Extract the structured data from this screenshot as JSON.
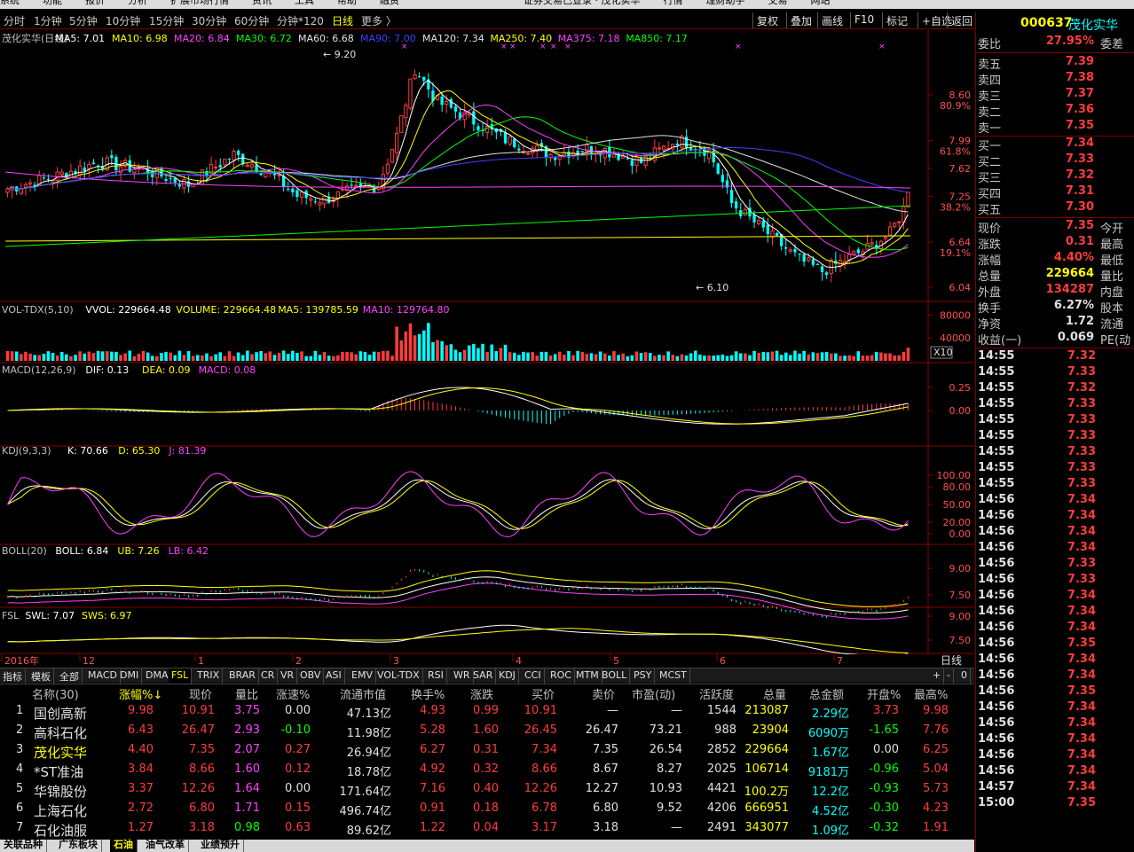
{
  "menubar": [
    "系统",
    "功能",
    "报价",
    "分析",
    "扩展市场行情",
    "资讯",
    "工具",
    "帮助",
    "融资",
    "证券交易已登录 · 茂化实华",
    "行情",
    "理财助手",
    "交易",
    "网站"
  ],
  "period_bar": {
    "items": [
      "分时",
      "1分钟",
      "5分钟",
      "10分钟",
      "15分钟",
      "30分钟",
      "60分钟",
      "分钟*120",
      "日线",
      "更多 〉"
    ],
    "active": "日线",
    "buttons": [
      "复权",
      "叠加",
      "画线",
      "F10",
      "标记",
      "+自选",
      "返回"
    ]
  },
  "right_panel": {
    "code": "000637",
    "name": "茂化实华",
    "weibi": {
      "label": "委比",
      "value": "27.95%",
      "label2": "委差"
    },
    "asks": [
      {
        "label": "卖五",
        "price": "7.39"
      },
      {
        "label": "卖四",
        "price": "7.38"
      },
      {
        "label": "卖三",
        "price": "7.37"
      },
      {
        "label": "卖二",
        "price": "7.36"
      },
      {
        "label": "卖一",
        "price": "7.35"
      }
    ],
    "bids": [
      {
        "label": "买一",
        "price": "7.34"
      },
      {
        "label": "买二",
        "price": "7.33"
      },
      {
        "label": "买三",
        "price": "7.32"
      },
      {
        "label": "买四",
        "price": "7.31"
      },
      {
        "label": "买五",
        "price": "7.30"
      }
    ],
    "stats": [
      {
        "label": "现价",
        "value": "7.35",
        "label2": "今开",
        "color": "#ff3c3c"
      },
      {
        "label": "涨跌",
        "value": "0.31",
        "label2": "最高",
        "color": "#ff3c3c"
      },
      {
        "label": "涨幅",
        "value": "4.40%",
        "label2": "最低",
        "color": "#ff3c3c"
      },
      {
        "label": "总量",
        "value": "229664",
        "label2": "量比",
        "color": "#ffff00"
      },
      {
        "label": "外盘",
        "value": "134287",
        "label2": "内盘",
        "color": "#ff3c3c"
      },
      {
        "label": "换手",
        "value": "6.27%",
        "label2": "股本",
        "color": "#e0e0e0"
      },
      {
        "label": "净资",
        "value": "1.72",
        "label2": "流通",
        "color": "#e0e0e0"
      },
      {
        "label": "收益(一)",
        "value": "0.069",
        "label2": "PE(动",
        "color": "#e0e0e0"
      }
    ],
    "ticks": [
      {
        "time": "14:55",
        "price": "7.32"
      },
      {
        "time": "14:55",
        "price": "7.33"
      },
      {
        "time": "14:55",
        "price": "7.32"
      },
      {
        "time": "14:55",
        "price": "7.33"
      },
      {
        "time": "14:55",
        "price": "7.33"
      },
      {
        "time": "14:55",
        "price": "7.33"
      },
      {
        "time": "14:55",
        "price": "7.33"
      },
      {
        "time": "14:55",
        "price": "7.33"
      },
      {
        "time": "14:55",
        "price": "7.33"
      },
      {
        "time": "14:56",
        "price": "7.34"
      },
      {
        "time": "14:56",
        "price": "7.34"
      },
      {
        "time": "14:56",
        "price": "7.34"
      },
      {
        "time": "14:56",
        "price": "7.34"
      },
      {
        "time": "14:56",
        "price": "7.33"
      },
      {
        "time": "14:56",
        "price": "7.33"
      },
      {
        "time": "14:56",
        "price": "7.34"
      },
      {
        "time": "14:56",
        "price": "7.34"
      },
      {
        "time": "14:56",
        "price": "7.34"
      },
      {
        "time": "14:56",
        "price": "7.35"
      },
      {
        "time": "14:56",
        "price": "7.34"
      },
      {
        "time": "14:56",
        "price": "7.34"
      },
      {
        "time": "14:56",
        "price": "7.35"
      },
      {
        "time": "14:56",
        "price": "7.34"
      },
      {
        "time": "14:56",
        "price": "7.34"
      },
      {
        "time": "14:56",
        "price": "7.34"
      },
      {
        "time": "14:56",
        "price": "7.34"
      },
      {
        "time": "14:56",
        "price": "7.34"
      },
      {
        "time": "14:57",
        "price": "7.34"
      },
      {
        "time": "15:00",
        "price": "7.35"
      }
    ]
  },
  "chart": {
    "title": "茂化实华(日线)",
    "ma_labels": [
      {
        "text": "MA5: 7.01",
        "color": "#ffffff"
      },
      {
        "text": "MA10: 6.98",
        "color": "#ffff00"
      },
      {
        "text": "MA20: 6.84",
        "color": "#ff40ff"
      },
      {
        "text": "MA30: 6.72",
        "color": "#00ff00"
      },
      {
        "text": "MA60: 6.68",
        "color": "#e0e0e0"
      },
      {
        "text": "MA90: 7.00",
        "color": "#4040ff"
      },
      {
        "text": "MA120: 7.34",
        "color": "#e0e0e0"
      },
      {
        "text": "MA250: 7.40",
        "color": "#ffff00"
      },
      {
        "text": "MA375: 7.18",
        "color": "#ff40ff"
      },
      {
        "text": "MA850: 7.17",
        "color": "#00ff00"
      }
    ],
    "price_ticks": [
      "8.60",
      "7.99",
      "7.62",
      "7.25",
      "6.64",
      "6.04"
    ],
    "pct_ticks": [
      "80.9%",
      "61.8%",
      "38.2%",
      "19.1%"
    ],
    "high_label": "9.20",
    "low_label": "6.10",
    "vol_title": "VOL-TDX(5,10)",
    "vol_labels": [
      {
        "text": "VVOL: 229664.48",
        "color": "#ffffff"
      },
      {
        "text": "VOLUME: 229664.48",
        "color": "#ffff00"
      },
      {
        "text": "MA5: 139785.59",
        "color": "#ffff00"
      },
      {
        "text": "MA10: 129764.80",
        "color": "#ff40ff"
      }
    ],
    "vol_ticks": [
      "80000",
      "40000"
    ],
    "vol_unit": "X10",
    "macd_title": "MACD(12,26,9)",
    "macd_labels": [
      {
        "text": "DIF: 0.13",
        "color": "#ffffff"
      },
      {
        "text": "DEA: 0.09",
        "color": "#ffff00"
      },
      {
        "text": "MACD: 0.08",
        "color": "#ff40ff"
      }
    ],
    "macd_ticks": [
      "0.25",
      "0.00"
    ],
    "kdj_title": "KDJ(9,3,3)",
    "kdj_labels": [
      {
        "text": "K: 70.66",
        "color": "#ffffff"
      },
      {
        "text": "D: 65.30",
        "color": "#ffff00"
      },
      {
        "text": "J: 81.39",
        "color": "#ff40ff"
      }
    ],
    "kdj_ticks": [
      "100.00",
      "80.00",
      "50.00",
      "20.00",
      "0.00"
    ],
    "boll_title": "BOLL(20)",
    "boll_labels": [
      {
        "text": "BOLL: 6.84",
        "color": "#ffffff"
      },
      {
        "text": "UB: 7.26",
        "color": "#ffff00"
      },
      {
        "text": "LB: 6.42",
        "color": "#ff40ff"
      }
    ],
    "boll_ticks": [
      "9.00",
      "7.50"
    ],
    "fsl_title": "FSL",
    "fsl_labels": [
      {
        "text": "SWL: 7.07",
        "color": "#ffffff"
      },
      {
        "text": "SWS: 6.97",
        "color": "#ffff00"
      }
    ],
    "fsl_ticks": [
      "9.00",
      "7.50"
    ],
    "date_axis": [
      "2016年",
      "12",
      "1",
      "2",
      "3",
      "4",
      "5",
      "6",
      "7"
    ],
    "period_label": "日线"
  },
  "indicator_tabs": [
    "指标",
    "模板",
    "全部",
    "MACD",
    "DMI",
    "DMA",
    "FSL",
    "TRIX",
    "BRAR",
    "CR",
    "VR",
    "OBV",
    "ASI",
    "EMV",
    "VOL-TDX",
    "RSI",
    "WR",
    "SAR",
    "KDJ",
    "CCI",
    "ROC",
    "MTM",
    "BOLL",
    "PSY",
    "MCST"
  ],
  "active_indicator_tab": "FSL",
  "nav_buttons": [
    "+",
    "-",
    "0"
  ],
  "table": {
    "headers": [
      "名称(30)",
      "涨幅%↓",
      "现价",
      "量比",
      "涨速%",
      "流通市值",
      "换手%",
      "涨跌",
      "买价",
      "卖价",
      "市盈(动)",
      "活跃度",
      "总量",
      "总金额",
      "开盘%",
      "最高%"
    ],
    "rows": [
      {
        "idx": "1",
        "name": "国创高新",
        "cells": [
          "9.98",
          "10.91",
          "3.75",
          "0.00",
          "47.13亿",
          "4.93",
          "0.99",
          "10.91",
          "—",
          "—",
          "1544",
          "213087",
          "2.29亿",
          "3.73",
          "9.98"
        ]
      },
      {
        "idx": "2",
        "name": "高科石化",
        "cells": [
          "6.43",
          "26.47",
          "2.93",
          "-0.10",
          "11.98亿",
          "5.28",
          "1.60",
          "26.45",
          "26.47",
          "73.21",
          "988",
          "23904",
          "6090万",
          "-1.65",
          "7.76"
        ]
      },
      {
        "idx": "3",
        "name": "茂化实华",
        "cells": [
          "4.40",
          "7.35",
          "2.07",
          "0.27",
          "26.94亿",
          "6.27",
          "0.31",
          "7.34",
          "7.35",
          "26.54",
          "2852",
          "229664",
          "1.67亿",
          "0.00",
          "6.25"
        ]
      },
      {
        "idx": "4",
        "name": "*ST准油",
        "cells": [
          "3.84",
          "8.66",
          "1.60",
          "0.12",
          "18.78亿",
          "4.92",
          "0.32",
          "8.66",
          "8.67",
          "8.27",
          "2025",
          "106714",
          "9181万",
          "-0.96",
          "5.04"
        ]
      },
      {
        "idx": "5",
        "name": "华锦股份",
        "cells": [
          "3.37",
          "12.26",
          "1.64",
          "0.00",
          "171.64亿",
          "7.16",
          "0.40",
          "12.26",
          "12.27",
          "10.93",
          "4421",
          "100.2万",
          "12.2亿",
          "-0.93",
          "5.73"
        ]
      },
      {
        "idx": "6",
        "name": "上海石化",
        "cells": [
          "2.72",
          "6.80",
          "1.71",
          "0.15",
          "496.74亿",
          "0.91",
          "0.18",
          "6.78",
          "6.80",
          "9.52",
          "4206",
          "666951",
          "4.52亿",
          "-0.30",
          "4.23"
        ]
      },
      {
        "idx": "7",
        "name": "石化油服",
        "cells": [
          "1.27",
          "3.18",
          "0.98",
          "0.63",
          "89.62亿",
          "1.22",
          "0.04",
          "3.17",
          "3.18",
          "—",
          "2491",
          "343077",
          "1.09亿",
          "-0.32",
          "1.91"
        ]
      }
    ]
  },
  "bottom_tabs": [
    "关联品种",
    "广东板块",
    "石油",
    "油气改革",
    "业绩预升"
  ],
  "active_bottom_tab": "石油"
}
